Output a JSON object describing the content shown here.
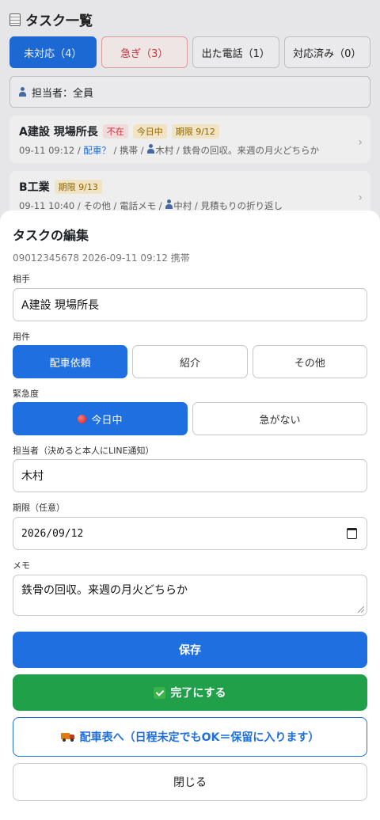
{
  "page": {
    "title": "タスク一覧",
    "tabs": [
      {
        "label": "未対応（4）"
      },
      {
        "label": "急ぎ（3）"
      },
      {
        "label": "出た電話（1）"
      },
      {
        "label": "対応済み（0）"
      }
    ],
    "assignee_filter": "担当者：全員",
    "cards": [
      {
        "name": "A建設 現場所長",
        "badges": [
          "不在",
          "今日中",
          "期限 9/12"
        ],
        "meta_prefix": "09-11 09:12 / ",
        "meta_link": "配車？",
        "meta_mid": " / 携帯 / ",
        "meta_person": "木村",
        "meta_suffix": " / 鉄骨の回収。来週の月火どちらか"
      },
      {
        "name": "B工業",
        "badges": [
          "期限 9/13"
        ],
        "meta_prefix": "09-11 10:40 / その他 / 電話メモ / ",
        "meta_person": "中村",
        "meta_suffix": " / 見積もりの折り返し"
      }
    ]
  },
  "modal": {
    "title": "タスクの編集",
    "subtitle": "09012345678 2026-09-11 09:12 携帯",
    "partner": {
      "label": "相手",
      "value": "A建設 現場所長"
    },
    "purpose": {
      "label": "用件",
      "options": [
        "配車依頼",
        "紹介",
        "その他"
      ],
      "selected": "配車依頼"
    },
    "urgency": {
      "label": "緊急度",
      "options": [
        "今日中",
        "急がない"
      ],
      "selected": "今日中"
    },
    "assignee": {
      "label": "担当者（決めると本人にLINE通知）",
      "value": "木村"
    },
    "due": {
      "label": "期限（任意）",
      "value": "2026/09/12"
    },
    "memo": {
      "label": "メモ",
      "value": "鉄骨の回収。来週の月火どちらか"
    },
    "buttons": {
      "save": "保存",
      "complete": "完了にする",
      "dispatch": "配車表へ（日程未定でもOK＝保留に入ります）",
      "close": "閉じる"
    }
  },
  "colors": {
    "accent": "#1e6fe0",
    "success": "#1fa049",
    "urgent": "#d8353b"
  }
}
